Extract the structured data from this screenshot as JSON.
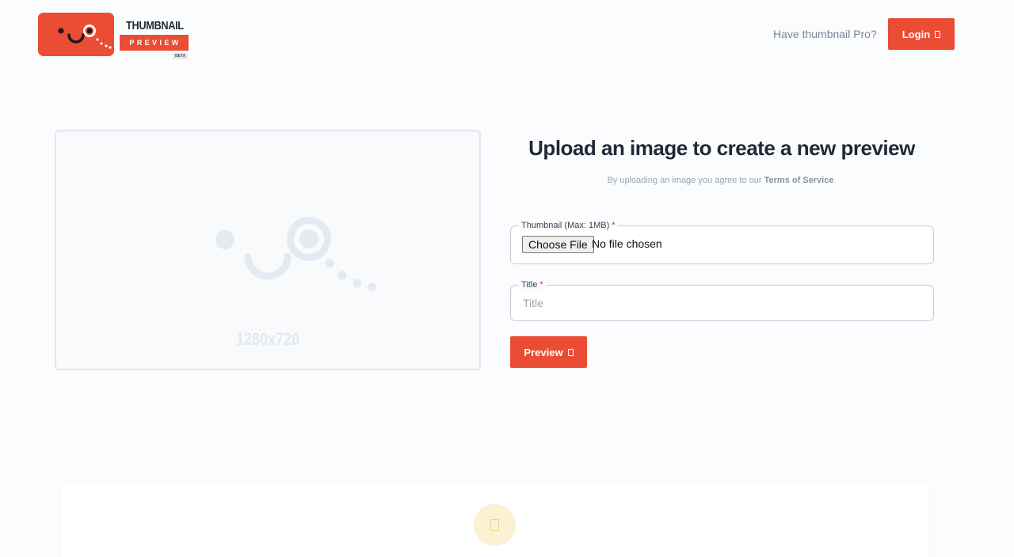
{
  "header": {
    "logo": {
      "word1": "THUMBNAIL",
      "word2": "PREVIEW",
      "badge": "BETA"
    },
    "pro_link": "Have thumbnail Pro?",
    "login_label": "Login",
    "login_icon": "box-icon"
  },
  "placeholder": {
    "size_label": "1280x720",
    "icon": "thumbnail-face-icon"
  },
  "form": {
    "title": "Upload an image to create a new preview",
    "subtitle_prefix": "By uploading an image you agree to our ",
    "tos_link": "Terms of Service",
    "subtitle_suffix": ".",
    "file_field": {
      "label": "Thumbnail (Max: 1MB)",
      "required_mark": "*",
      "button_label": "Choose File",
      "status": "No file chosen"
    },
    "title_field": {
      "label": "Title",
      "required_mark": "*",
      "placeholder": "Title",
      "value": ""
    },
    "preview_label": "Preview",
    "preview_icon": "box-icon"
  },
  "card": {
    "icon": "box-icon"
  },
  "colors": {
    "accent": "#ea4c34",
    "background": "#fbfcfe",
    "required": "#e11d48",
    "card_icon_bg": "#fbf1d3"
  }
}
